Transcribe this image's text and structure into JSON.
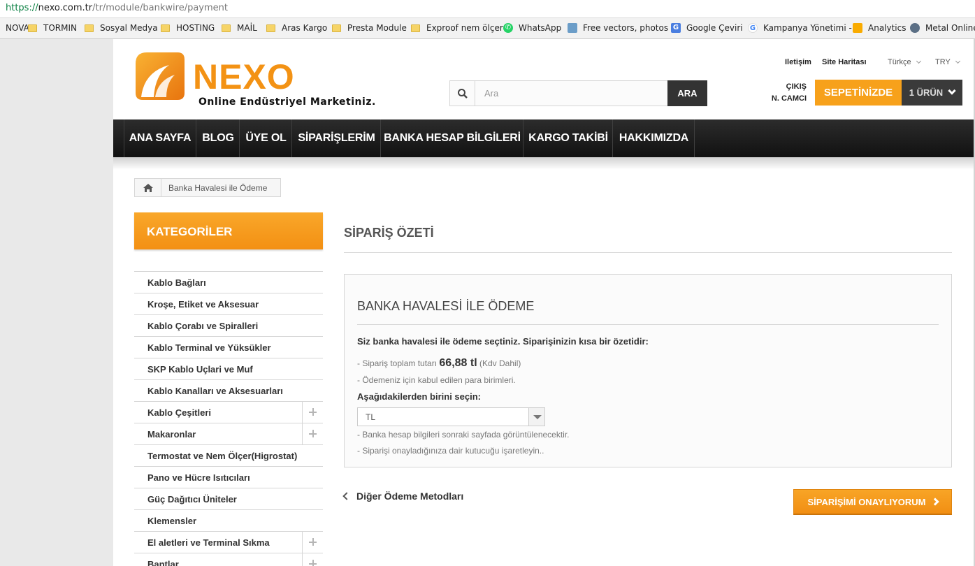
{
  "browser": {
    "url_protocol": "https://",
    "url_host": "nexo.com.tr",
    "url_path": "/tr/module/bankwire/payment",
    "bookmarks": [
      {
        "label": "NOVA",
        "icon": "folder-icon"
      },
      {
        "label": "TORMIN",
        "icon": "folder-icon"
      },
      {
        "label": "Sosyal Medya",
        "icon": "folder-icon"
      },
      {
        "label": "HOSTING",
        "icon": "folder-icon"
      },
      {
        "label": "MAİL",
        "icon": "folder-icon"
      },
      {
        "label": "Aras Kargo",
        "icon": "folder-icon"
      },
      {
        "label": "Presta Module",
        "icon": "folder-icon"
      },
      {
        "label": "Exproof nem ölçer",
        "icon": "folder-icon"
      },
      {
        "label": "WhatsApp",
        "icon": "whatsapp-icon"
      },
      {
        "label": "Free vectors, photos",
        "icon": "freepik-icon"
      },
      {
        "label": "Google Çeviri",
        "icon": "google-translate-icon"
      },
      {
        "label": "Kampanya Yönetimi -",
        "icon": "google-icon"
      },
      {
        "label": "Analytics",
        "icon": "analytics-icon"
      },
      {
        "label": "Metal Online",
        "icon": "metal-online-icon"
      }
    ]
  },
  "site": {
    "logo_text": "NEXO",
    "tagline": "Online Endüstriyel Marketiniz."
  },
  "header": {
    "contact_link": "Iletişim",
    "sitemap_link": "Site Haritası",
    "language": "Türkçe",
    "currency": "TRY",
    "logout_label": "ÇIKIŞ",
    "user_name": "N. CAMCI",
    "search_placeholder": "Ara",
    "search_button": "ARA",
    "cart_label": "SEPETİNİZDE",
    "cart_count": "1 ÜRÜN"
  },
  "nav": {
    "items": [
      "ANA SAYFA",
      "BLOG",
      "ÜYE OL",
      "SİPARİŞLERİM",
      "BANKA HESAP BİLGİLERİ",
      "KARGO TAKİBİ",
      "HAKKIMIZDA"
    ]
  },
  "breadcrumb": {
    "current": "Banka Havalesi ile Ödeme"
  },
  "sidebar": {
    "title": "KATEGORİLER",
    "items": [
      {
        "label": "Kablo Bağları",
        "expandable": false
      },
      {
        "label": "Kroşe, Etiket ve Aksesuar",
        "expandable": false
      },
      {
        "label": "Kablo Çorabı ve Spiralleri",
        "expandable": false
      },
      {
        "label": "Kablo Terminal ve Yüksükler",
        "expandable": false
      },
      {
        "label": "SKP Kablo Uçlari ve Muf",
        "expandable": false
      },
      {
        "label": "Kablo Kanalları ve Aksesuarları",
        "expandable": false
      },
      {
        "label": "Kablo Çeşitleri",
        "expandable": true
      },
      {
        "label": "Makaronlar",
        "expandable": true
      },
      {
        "label": "Termostat ve Nem Ölçer(Higrostat)",
        "expandable": false
      },
      {
        "label": "Pano ve Hücre Isıtıcıları",
        "expandable": false
      },
      {
        "label": "Güç Dağıtıcı Üniteler",
        "expandable": false
      },
      {
        "label": "Klemensler",
        "expandable": false
      },
      {
        "label": "El aletleri ve Terminal Sıkma",
        "expandable": true
      },
      {
        "label": "Bantlar",
        "expandable": true
      }
    ]
  },
  "main": {
    "heading": "SİPARİŞ ÖZETİ",
    "box_title": "BANKA HAVALESİ İLE ÖDEME",
    "intro": "Siz banka havalesi ile ödeme seçtiniz. Siparişinizin kısa bir özetidir:",
    "total_prefix": "- Sipariş toplam tutarı",
    "total_amount": "66,88 tl",
    "total_suffix": "(Kdv Dahil)",
    "currencies_line": "- Ödemeniz için kabul edilen para birimleri.",
    "choose_label": "Aşağıdakilerden birini seçin:",
    "currency_selected": "TL",
    "info_line_1": "- Banka hesap bilgileri sonraki sayfada görüntülenecektir.",
    "info_line_2": "- Siparişi onayladığınıza dair kutucuğu işaretleyin..",
    "other_methods": "Diğer Ödeme Metodları",
    "confirm_button": "SİPARİŞİMİ ONAYLIYORUM"
  },
  "colors": {
    "accent": "#f7a11b",
    "nav_bg": "#1a1a1a",
    "dark_button": "#333333"
  }
}
